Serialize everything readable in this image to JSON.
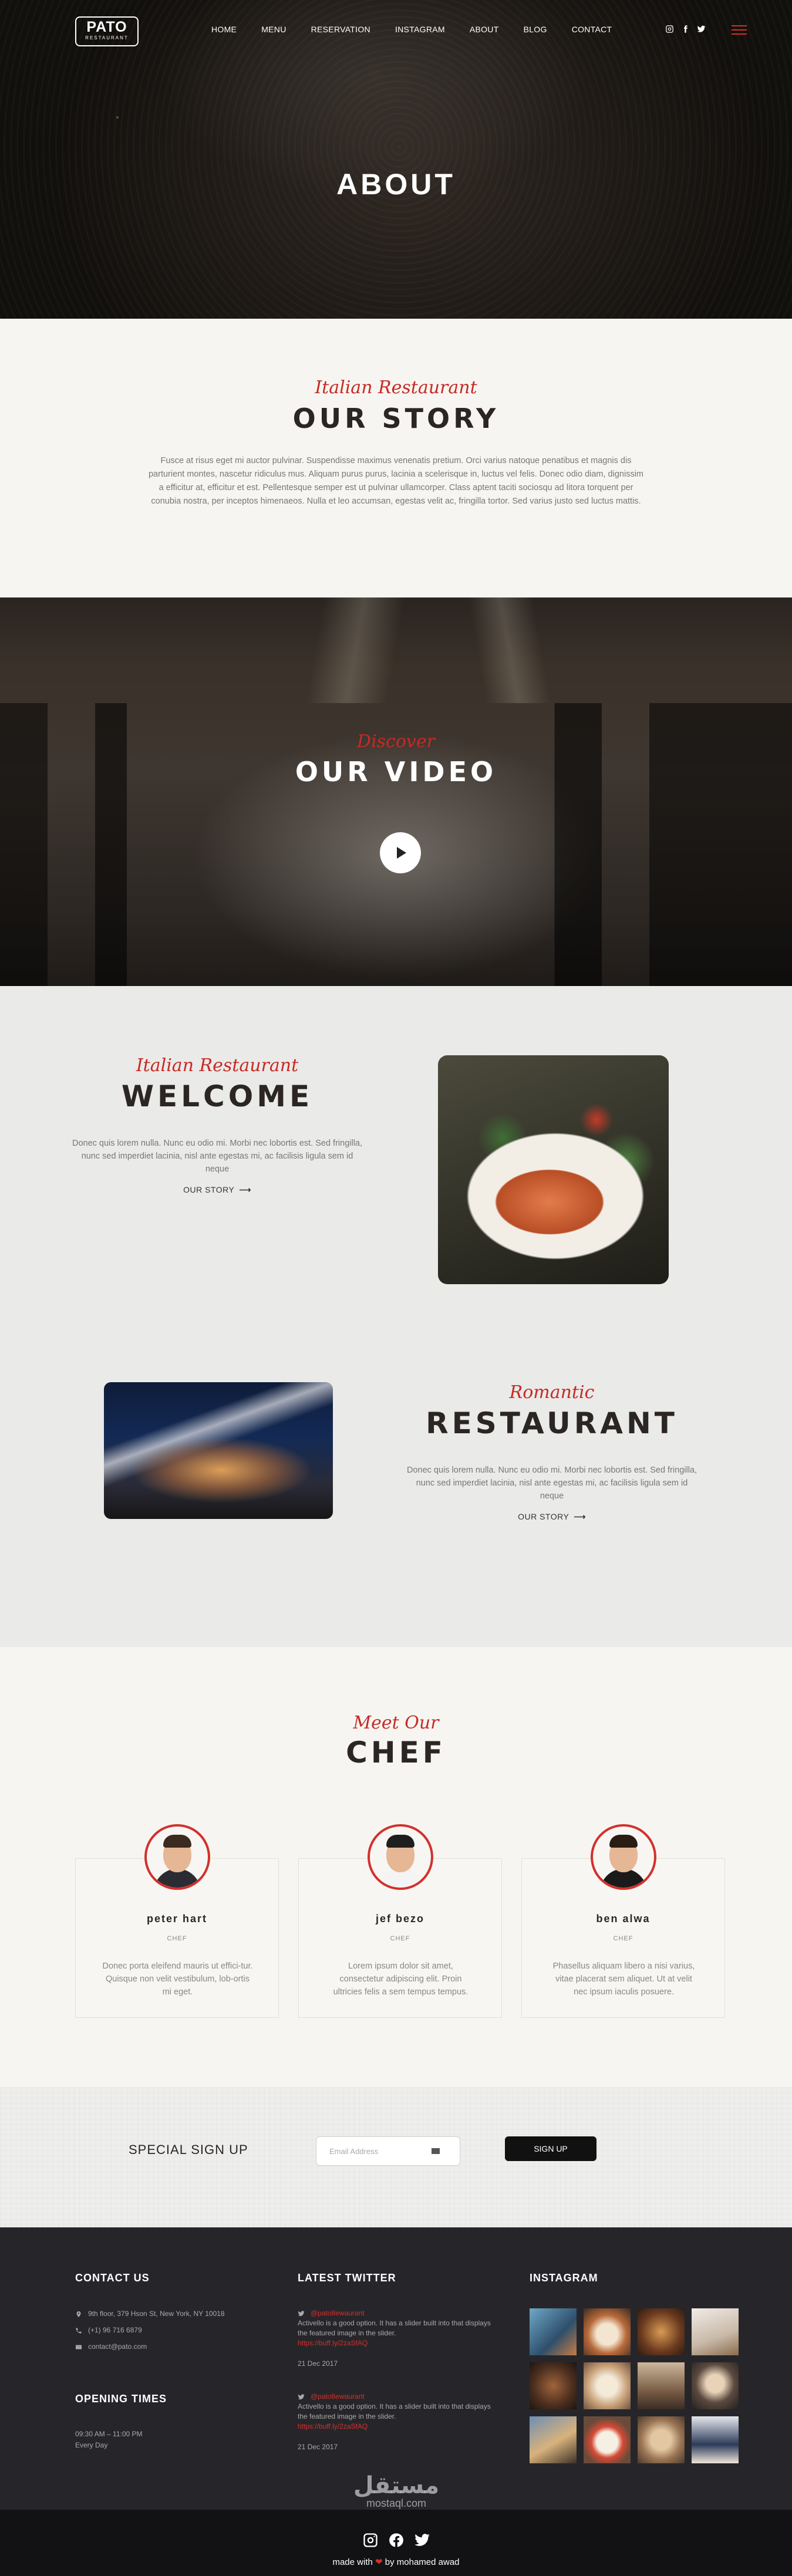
{
  "nav": {
    "logo": "PATO",
    "logo_sub": "RESTAURANT",
    "items": [
      "HOME",
      "MENU",
      "RESERVATION",
      "INSTAGRAM",
      "ABOUT",
      "BLOG",
      "CONTACT"
    ]
  },
  "hero": {
    "title": "ABOUT"
  },
  "story": {
    "script": "Italian Restaurant",
    "title": "OUR STORY",
    "text": "Fusce at risus eget mi auctor pulvinar. Suspendisse maximus venenatis pretium. Orci varius natoque penatibus et magnis dis parturient montes, nascetur ridiculus mus. Aliquam purus purus, lacinia a scelerisque in, luctus vel felis. Donec odio diam, dignissim a efficitur at, efficitur et est. Pellentesque semper est ut pulvinar ullamcorper. Class aptent taciti sociosqu ad litora torquent per conubia nostra, per inceptos himenaeos. Nulla et leo accumsan, egestas velit ac, fringilla tortor. Sed varius justo sed luctus mattis."
  },
  "video": {
    "script": "Discover",
    "title": "OUR VIDEO"
  },
  "welcome": {
    "script": "Italian Restaurant",
    "title": "WELCOME",
    "text": "Donec quis lorem nulla. Nunc eu odio mi. Morbi nec lobortis est. Sed fringilla, nunc sed imperdiet lacinia, nisl ante egestas mi, ac facilisis ligula sem id neque",
    "link": "OUR STORY"
  },
  "restaurant": {
    "script": "Romantic",
    "title": "RESTAURANT",
    "text": "Donec quis lorem nulla. Nunc eu odio mi. Morbi nec lobortis est. Sed fringilla, nunc sed imperdiet lacinia, nisl ante egestas mi, ac facilisis ligula sem id neque",
    "link": "OUR STORY"
  },
  "chef": {
    "script": "Meet Our",
    "title": "CHEF",
    "members": [
      {
        "name": "peter hart",
        "role": "CHEF",
        "desc": "Donec porta eleifend mauris ut effici-tur. Quisque non velit vestibulum, lob-ortis mi eget."
      },
      {
        "name": "jef bezo",
        "role": "CHEF",
        "desc": "Lorem ipsum dolor sit amet, consectetur adipiscing elit. Proin ultricies felis a sem tempus tempus."
      },
      {
        "name": "ben alwa",
        "role": "CHEF",
        "desc": "Phasellus aliquam libero a nisi varius, vitae placerat sem aliquet. Ut at velit nec ipsum iaculis posuere."
      }
    ]
  },
  "signup": {
    "title": "SPECIAL SIGN UP",
    "placeholder": "Email Address",
    "button": "SIGN UP"
  },
  "footer": {
    "contact_title": "CONTACT US",
    "address": "9th floor, 379 Hson St, New York, NY 10018",
    "phone": "(+1) 96 716 6879",
    "email": "contact@pato.com",
    "hours_title": "OPENING TIMES",
    "hours": "09:30 AM – 11:00 PM",
    "hours_days": "Every Day",
    "twitter_title": "LATEST TWITTER",
    "tweets": [
      {
        "handle": "@pato8ewaurant",
        "text": "Activello is a good option. It has a slider built into that displays the featured image in the slider.",
        "link": "https://buff.ly/2zaSfAQ",
        "date": "21 Dec 2017"
      },
      {
        "handle": "@pato8ewaurant",
        "text": "Activello is a good option. It has a slider built into that displays the featured image in the slider.",
        "link": "https://buff.ly/2zaSfAQ",
        "date": "21 Dec 2017"
      }
    ],
    "instagram_title": "INSTAGRAM",
    "watermark_ar": "مستقل",
    "watermark_en": "mostaql.com"
  },
  "bottom": {
    "made_with": "made with",
    "by": "by mohamed awad"
  },
  "colors": {
    "accent": "#d3302d",
    "dark": "#26262a",
    "footer_bottom": "#121214"
  },
  "icons": [
    "instagram-icon",
    "facebook-icon",
    "twitter-icon",
    "menu-icon",
    "play-icon",
    "arrow-right-icon",
    "envelope-icon",
    "location-icon",
    "phone-icon",
    "mail-icon",
    "heart-icon"
  ]
}
